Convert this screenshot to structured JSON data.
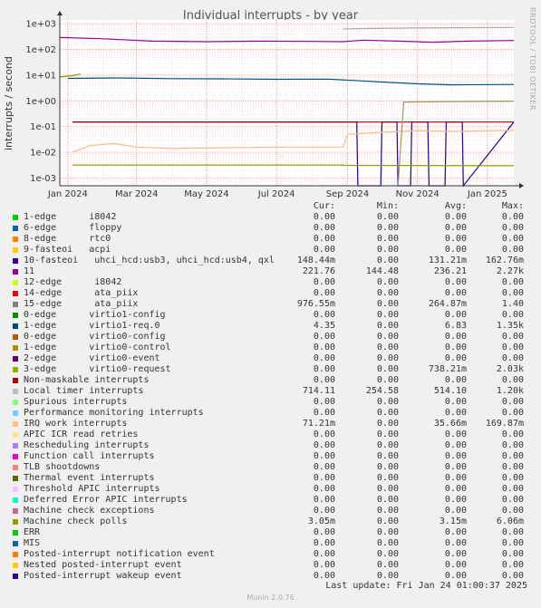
{
  "title": "Individual interrupts - by year",
  "watermark": "RRDTOOL / TOBI OETIKER",
  "ylabel": "interrupts / second",
  "chart_data": {
    "type": "line",
    "title": "Individual interrupts - by year",
    "ylabel": "interrupts / second",
    "yscale": "log",
    "ylim": [
      0.0005,
      1400
    ],
    "ytick_values": [
      0.001,
      0.01,
      0.1,
      1,
      10,
      100,
      1000
    ],
    "ytick_labels": [
      "1e-03",
      "1e-02",
      "1e-01",
      "1e+00",
      "1e+01",
      "1e+02",
      "1e+03"
    ],
    "x_range": [
      "2023-12-25",
      "2025-01-24"
    ],
    "x_ticks": [
      {
        "date": "2024-01-01",
        "label": "Jan 2024"
      },
      {
        "date": "2024-03-01",
        "label": "Mar 2024"
      },
      {
        "date": "2024-05-01",
        "label": "May 2024"
      },
      {
        "date": "2024-07-01",
        "label": "Jul 2024"
      },
      {
        "date": "2024-09-01",
        "label": "Sep 2024"
      },
      {
        "date": "2024-11-01",
        "label": "Nov 2024"
      },
      {
        "date": "2025-01-01",
        "label": "Jan 2025"
      }
    ],
    "grid": true,
    "series": [
      {
        "name": "11",
        "color": "#990099",
        "x": [
          "2023-12-25",
          "2024-02-01",
          "2024-03-15",
          "2024-05-01",
          "2024-06-15",
          "2024-08-01",
          "2024-08-28",
          "2024-09-15",
          "2024-10-15",
          "2024-11-15",
          "2024-12-15",
          "2025-01-24"
        ],
        "y": [
          290,
          260,
          210,
          200,
          210,
          205,
          200,
          230,
          210,
          190,
          210,
          221.76
        ]
      },
      {
        "name": "Local timer interrupts",
        "color": "#aaaaaa",
        "x": [
          "2024-08-28",
          "2024-09-15",
          "2024-11-01",
          "2025-01-24"
        ],
        "y": [
          620,
          650,
          680,
          714.11
        ]
      },
      {
        "name": "1-edge      virtio1-req.0",
        "color": "#005577",
        "x": [
          "2024-01-01",
          "2024-02-15",
          "2024-04-01",
          "2024-05-15",
          "2024-07-01",
          "2024-08-15",
          "2024-10-01",
          "2024-11-01",
          "2024-12-01",
          "2025-01-24"
        ],
        "y": [
          7.5,
          7.8,
          7.3,
          7.2,
          6.9,
          7.0,
          5.4,
          4.6,
          4.2,
          4.35
        ]
      },
      {
        "name": "3-edge      virtio0-request",
        "color": "#889900",
        "x": [
          "2023-12-25",
          "2024-01-05",
          "2024-01-12"
        ],
        "y": [
          8.5,
          9.5,
          11
        ]
      },
      {
        "name": "10-fasteoi   uhci_hcd:usb3, uhci_hcd:usb4, qxl",
        "color": "#200090",
        "x": [
          "2024-01-05",
          "2024-08-28",
          "2024-09-09",
          "2024-09-10",
          "2024-09-30",
          "2024-10-01",
          "2024-10-14",
          "2024-10-15",
          "2024-10-26",
          "2024-10-27",
          "2024-11-10",
          "2024-11-11",
          "2024-11-25",
          "2024-11-26",
          "2024-12-10",
          "2024-12-11",
          "2025-01-24"
        ],
        "y": [
          0.15,
          0.15,
          0.15,
          0.0005,
          0.0005,
          0.15,
          0.15,
          0.0005,
          0.0005,
          0.15,
          0.15,
          0.0005,
          0.0005,
          0.15,
          0.15,
          0.0005,
          0.15
        ]
      },
      {
        "name": "Non-maskable interrupts",
        "color": "#990000",
        "x": [
          "2024-01-05",
          "2024-11-01",
          "2025-01-24"
        ],
        "y": [
          0.15,
          0.15,
          0.15
        ]
      },
      {
        "name": "IRQ work interrupts",
        "color": "#ffbb88",
        "x": [
          "2024-01-05",
          "2024-01-20",
          "2024-02-10",
          "2024-03-01",
          "2024-04-01",
          "2024-05-15",
          "2024-07-01",
          "2024-08-15",
          "2024-08-28",
          "2024-09-01",
          "2024-10-01",
          "2024-11-01",
          "2024-12-01",
          "2025-01-24"
        ],
        "y": [
          0.01,
          0.018,
          0.022,
          0.016,
          0.014,
          0.015,
          0.016,
          0.016,
          0.016,
          0.05,
          0.06,
          0.07,
          0.065,
          0.07121
        ]
      },
      {
        "name": "Machine check polls",
        "color": "#8da000",
        "x": [
          "2024-01-05",
          "2024-08-28",
          "2024-08-28",
          "2025-01-24"
        ],
        "y": [
          0.0032,
          0.0032,
          0.0031,
          0.003
        ]
      },
      {
        "name": "15-edge      ata_piix",
        "color": "#999966",
        "x": [
          "2024-10-15",
          "2024-10-20",
          "2025-01-24"
        ],
        "y": [
          0.0005,
          0.9,
          0.98
        ]
      }
    ]
  },
  "legend": {
    "headers": {
      "cur": "Cur:",
      "min": "Min:",
      "avg": "Avg:",
      "max": "Max:"
    },
    "rows": [
      {
        "color": "#00cc00",
        "name": "1-edge      i8042",
        "cur": "0.00",
        "min": "0.00",
        "avg": "0.00",
        "max": "0.00"
      },
      {
        "color": "#0066b3",
        "name": "6-edge      floppy",
        "cur": "0.00",
        "min": "0.00",
        "avg": "0.00",
        "max": "0.00"
      },
      {
        "color": "#ff8000",
        "name": "8-edge      rtc0",
        "cur": "0.00",
        "min": "0.00",
        "avg": "0.00",
        "max": "0.00"
      },
      {
        "color": "#ffcc00",
        "name": "9-fasteoi   acpi",
        "cur": "0.00",
        "min": "0.00",
        "avg": "0.00",
        "max": "0.00"
      },
      {
        "color": "#330099",
        "name": "10-fasteoi   uhci_hcd:usb3, uhci_hcd:usb4, qxl",
        "cur": "148.44m",
        "min": "0.00",
        "avg": "131.21m",
        "max": "162.76m"
      },
      {
        "color": "#990099",
        "name": "11",
        "cur": "221.76",
        "min": "144.48",
        "avg": "236.21",
        "max": "2.27k"
      },
      {
        "color": "#ccff00",
        "name": "12-edge      i8042",
        "cur": "0.00",
        "min": "0.00",
        "avg": "0.00",
        "max": "0.00"
      },
      {
        "color": "#ff0000",
        "name": "14-edge      ata_piix",
        "cur": "0.00",
        "min": "0.00",
        "avg": "0.00",
        "max": "0.00"
      },
      {
        "color": "#808080",
        "name": "15-edge      ata_piix",
        "cur": "976.55m",
        "min": "0.00",
        "avg": "264.87m",
        "max": "1.40"
      },
      {
        "color": "#008f00",
        "name": "0-edge      virtio1-config",
        "cur": "0.00",
        "min": "0.00",
        "avg": "0.00",
        "max": "0.00"
      },
      {
        "color": "#00487d",
        "name": "1-edge      virtio1-req.0",
        "cur": "4.35",
        "min": "0.00",
        "avg": "6.83",
        "max": "1.35k"
      },
      {
        "color": "#b35a00",
        "name": "0-edge      virtio0-config",
        "cur": "0.00",
        "min": "0.00",
        "avg": "0.00",
        "max": "0.00"
      },
      {
        "color": "#b38f00",
        "name": "1-edge      virtio0-control",
        "cur": "0.00",
        "min": "0.00",
        "avg": "0.00",
        "max": "0.00"
      },
      {
        "color": "#6b006b",
        "name": "2-edge      virtio0-event",
        "cur": "0.00",
        "min": "0.00",
        "avg": "0.00",
        "max": "0.00"
      },
      {
        "color": "#8fb300",
        "name": "3-edge      virtio0-request",
        "cur": "0.00",
        "min": "0.00",
        "avg": "738.21m",
        "max": "2.03k"
      },
      {
        "color": "#b30000",
        "name": "Non-maskable interrupts",
        "cur": "0.00",
        "min": "0.00",
        "avg": "0.00",
        "max": "0.00"
      },
      {
        "color": "#bebebe",
        "name": "Local timer interrupts",
        "cur": "714.11",
        "min": "254.58",
        "avg": "514.10",
        "max": "1.20k"
      },
      {
        "color": "#80ff80",
        "name": "Spurious interrupts",
        "cur": "0.00",
        "min": "0.00",
        "avg": "0.00",
        "max": "0.00"
      },
      {
        "color": "#80c9ff",
        "name": "Performance monitoring interrupts",
        "cur": "0.00",
        "min": "0.00",
        "avg": "0.00",
        "max": "0.00"
      },
      {
        "color": "#ffc080",
        "name": "IRQ work interrupts",
        "cur": "71.21m",
        "min": "0.00",
        "avg": "35.66m",
        "max": "169.87m"
      },
      {
        "color": "#ffe680",
        "name": "APIC ICR read retries",
        "cur": "0.00",
        "min": "0.00",
        "avg": "0.00",
        "max": "0.00"
      },
      {
        "color": "#aa80ff",
        "name": "Rescheduling interrupts",
        "cur": "0.00",
        "min": "0.00",
        "avg": "0.00",
        "max": "0.00"
      },
      {
        "color": "#ee00cc",
        "name": "Function call interrupts",
        "cur": "0.00",
        "min": "0.00",
        "avg": "0.00",
        "max": "0.00"
      },
      {
        "color": "#ff8080",
        "name": "TLB shootdowns",
        "cur": "0.00",
        "min": "0.00",
        "avg": "0.00",
        "max": "0.00"
      },
      {
        "color": "#666600",
        "name": "Thermal event interrupts",
        "cur": "0.00",
        "min": "0.00",
        "avg": "0.00",
        "max": "0.00"
      },
      {
        "color": "#ffbfff",
        "name": "Threshold APIC interrupts",
        "cur": "0.00",
        "min": "0.00",
        "avg": "0.00",
        "max": "0.00"
      },
      {
        "color": "#00ffcc",
        "name": "Deferred Error APIC interrupts",
        "cur": "0.00",
        "min": "0.00",
        "avg": "0.00",
        "max": "0.00"
      },
      {
        "color": "#cc6699",
        "name": "Machine check exceptions",
        "cur": "0.00",
        "min": "0.00",
        "avg": "0.00",
        "max": "0.00"
      },
      {
        "color": "#999900",
        "name": "Machine check polls",
        "cur": "3.05m",
        "min": "0.00",
        "avg": "3.15m",
        "max": "6.06m"
      },
      {
        "color": "#00cc00",
        "name": "ERR",
        "cur": "0.00",
        "min": "0.00",
        "avg": "0.00",
        "max": "0.00"
      },
      {
        "color": "#0066b3",
        "name": "MIS",
        "cur": "0.00",
        "min": "0.00",
        "avg": "0.00",
        "max": "0.00"
      },
      {
        "color": "#ff8000",
        "name": "Posted-interrupt notification event",
        "cur": "0.00",
        "min": "0.00",
        "avg": "0.00",
        "max": "0.00"
      },
      {
        "color": "#ffcc00",
        "name": "Nested posted-interrupt event",
        "cur": "0.00",
        "min": "0.00",
        "avg": "0.00",
        "max": "0.00"
      },
      {
        "color": "#330099",
        "name": "Posted-interrupt wakeup event",
        "cur": "0.00",
        "min": "0.00",
        "avg": "0.00",
        "max": "0.00"
      }
    ]
  },
  "last_update": "Last update: Fri Jan 24 01:00:37 2025",
  "footer": "Munin 2.0.76"
}
